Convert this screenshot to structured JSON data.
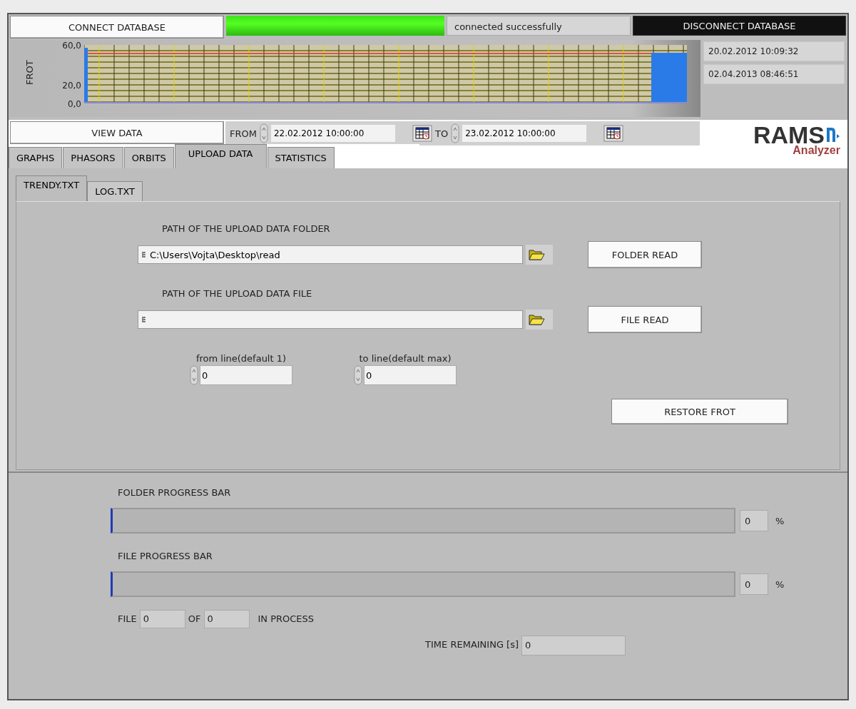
{
  "connect_button": "CONNECT DATABASE",
  "connection_indicator": {
    "on": true
  },
  "connection_status": "connected successfully",
  "disconnect_button": "DISCONNECT DATABASE",
  "chart": {
    "y_label": "FROT",
    "y_tick_labels": [
      "60,0",
      "20,0",
      "0,0"
    ]
  },
  "time_range": {
    "start": "20.02.2012 10:09:32",
    "end": "02.04.2013 08:46:51"
  },
  "logo": {
    "name": "RAMS",
    "subtitle": "Analyzer"
  },
  "view_button": "VIEW DATA",
  "from": {
    "label": "FROM",
    "value": "22.02.2012 10:00:00"
  },
  "to": {
    "label": "TO",
    "value": "23.02.2012 10:00:00"
  },
  "tabs": [
    {
      "label": "GRAPHS",
      "selected": false
    },
    {
      "label": "PHASORS",
      "selected": false
    },
    {
      "label": "ORBITS",
      "selected": false
    },
    {
      "label": "UPLOAD DATA",
      "selected": true
    },
    {
      "label": "STATISTICS",
      "selected": false
    }
  ],
  "subtabs": [
    {
      "label": "TRENDY.TXT",
      "selected": true
    },
    {
      "label": "LOG.TXT",
      "selected": false
    }
  ],
  "folder_path": {
    "label": "PATH OF THE UPLOAD DATA FOLDER",
    "value": "C:\\Users\\Vojta\\Desktop\\read",
    "button": "FOLDER READ"
  },
  "file_path": {
    "label": "PATH OF THE UPLOAD DATA FILE",
    "button": "FILE READ"
  },
  "from_line": {
    "label": "from line(default 1)",
    "value": "0"
  },
  "to_line": {
    "label": "to line(default max)",
    "value": "0"
  },
  "restore_button": "RESTORE FROT",
  "progress_bars": [
    {
      "label": "FOLDER PROGRESS BAR",
      "level": 0,
      "value": "0",
      "unit": "%"
    },
    {
      "label": "FILE PROGRESS BAR",
      "level": 0,
      "value": "0",
      "unit": "%"
    }
  ],
  "file_counter": {
    "label": "FILE",
    "value": "0",
    "of_label": "OF",
    "total": "0",
    "suffix": "IN PROCESS"
  },
  "time_remaining": {
    "label": "TIME REMAINING [s]",
    "value": "0"
  }
}
